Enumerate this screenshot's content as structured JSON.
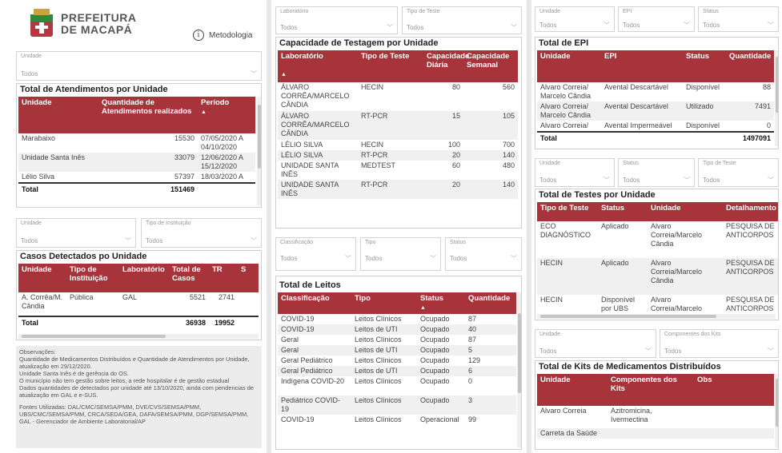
{
  "logo": {
    "line1": "PREFEITURA",
    "line2": "DE MACAPÁ",
    "metodologia": "Metodologia",
    "info_glyph": "i"
  },
  "col1": {
    "slicer_unidade": {
      "label": "Unidade",
      "value": "Todos"
    },
    "atend": {
      "title": "Total de Atendimentos por Unidade",
      "headers": [
        "Unidade",
        "Quantidade de Atendimentos realizados",
        "Período"
      ],
      "sort_glyph": "▲",
      "rows": [
        [
          "Marabaixo",
          "15530",
          "07/05/2020 A 04/10/2020"
        ],
        [
          "Unidade Santa Inês",
          "33079",
          "12/06/2020 A 15/12/2020"
        ],
        [
          "Lélio Silva",
          "57397",
          "18/03/2020 A"
        ]
      ],
      "total": [
        "Total",
        "151469",
        ""
      ]
    },
    "slicer_unidade2": {
      "label": "Unidade",
      "value": "Todos"
    },
    "slicer_tipo_inst": {
      "label": "Tipo de Instituição",
      "value": "Todos"
    },
    "casos": {
      "title": "Casos Detectados po Unidade",
      "headers": [
        "Unidade",
        "Tipo de Instituição",
        "Laboratório",
        "Total de Casos",
        "TR",
        "S"
      ],
      "rows": [
        [
          "A. Corrêa/M. Cândia",
          "Pública",
          "GAL",
          "5521",
          "2741",
          ""
        ]
      ],
      "total": [
        "Total",
        "",
        "",
        "36938",
        "19952",
        ""
      ]
    },
    "obs": [
      "Observações:",
      "Quantidade de Medicamentos Distribuídos e Quantidade de Atendimentos por Unidade, atualização em 29/12/2020.",
      "Unidade Santa Inês é de gerência do OS.",
      "O município não tem gestão sobre leitos, a rede hospitalar é de gestão estadual",
      "Dados quantidades de detectados por unidade até 13/10/2020, ainda com pendencias de atualização em GAL e e-SUS.",
      "",
      "Fontes Utilizadas: DAL/CMC/SEMSA/PMM, DVE/CVS/SEMSA/PMM, UBS/CMC/SEMSA/PMM, CRCA/SEDA/GEA, DAFA/SEMSA/PMM, DGP/SEMSA/PMM, GAL - Gerenciador de Ambiente Laboratorial/AP"
    ]
  },
  "col2": {
    "slicer_lab": {
      "label": "Laboratório",
      "value": "Todos"
    },
    "slicer_tipo_teste": {
      "label": "Tipo de Teste",
      "value": "Todos"
    },
    "cap": {
      "title": "Capacidade de Testagem por Unidade",
      "headers": [
        "Laboratório",
        "Tipo de Teste",
        "Capacidade Diária",
        "Capacidade Semanal"
      ],
      "sort_glyph": "▲",
      "rows": [
        [
          "ÁLVARO CORRÊA/MARCELO CÂNDIA",
          "HECIN",
          "80",
          "560"
        ],
        [
          "ÁLVARO CORRÊA/MARCELO CÂNDIA",
          "RT-PCR",
          "15",
          "105"
        ],
        [
          "LÉLIO SILVA",
          "HECIN",
          "100",
          "700"
        ],
        [
          "LÉLIO SILVA",
          "RT-PCR",
          "20",
          "140"
        ],
        [
          "UNIDADE SANTA INÊS",
          "MEDTEST",
          "60",
          "480"
        ],
        [
          "UNIDADE SANTA INÊS",
          "RT-PCR",
          "20",
          "140"
        ]
      ]
    },
    "slicer_class": {
      "label": "Classificação",
      "value": "Todos"
    },
    "slicer_tipo": {
      "label": "Tipo",
      "value": "Todos"
    },
    "slicer_status": {
      "label": "Status",
      "value": "Todos"
    },
    "leitos": {
      "title": "Total de Leitos",
      "headers": [
        "Classificação",
        "Tipo",
        "Status",
        "Quantidade"
      ],
      "sort_glyph": "▲",
      "rows": [
        [
          "COVID-19",
          "Leitos Clínicos",
          "Ocupado",
          "87"
        ],
        [
          "COVID-19",
          "Leitos de UTI",
          "Ocupado",
          "40"
        ],
        [
          "Geral",
          "Leitos Clínicos",
          "Ocupado",
          "87"
        ],
        [
          "Geral",
          "Leitos de UTI",
          "Ocupado",
          "5"
        ],
        [
          "Geral Pediátrico",
          "Leitos Clínicos",
          "Ocupado",
          "129"
        ],
        [
          "Geral Pediátrico",
          "Leitos de UTI",
          "Ocupado",
          "6"
        ],
        [
          "Indígena COVID-20",
          "Leitos Clínicos",
          "Ocupado",
          "0"
        ],
        [
          "Pediátrico COVID-19",
          "Leitos Clínicos",
          "Ocupado",
          "3"
        ],
        [
          "COVID-19",
          "Leitos Clínicos",
          "Operacional",
          "99"
        ]
      ]
    }
  },
  "col3": {
    "slicer_unidade": {
      "label": "Unidade",
      "value": "Todos"
    },
    "slicer_epi": {
      "label": "EPI",
      "value": "Todos"
    },
    "slicer_status": {
      "label": "Status",
      "value": "Todos"
    },
    "epi": {
      "title": "Total de EPI",
      "headers": [
        "Unidade",
        "EPI",
        "Status",
        "Quantidade"
      ],
      "rows": [
        [
          "Alvaro Correia/ Marcelo Cândia",
          "Avental Descartável",
          "Disponível",
          "88"
        ],
        [
          "Alvaro Correia/ Marcelo Cândia",
          "Avental Descartável",
          "Utilizado",
          "7491"
        ],
        [
          "Alvaro Correia/",
          "Avental Impermeável",
          "Disponível",
          "0"
        ]
      ],
      "total": [
        "Total",
        "",
        "",
        "1497091"
      ]
    },
    "slicer_unidade2": {
      "label": "Unidade",
      "value": "Todos"
    },
    "slicer_status2": {
      "label": "Status",
      "value": "Todos"
    },
    "slicer_tipo_teste": {
      "label": "Tipo de Teste",
      "value": "Todos"
    },
    "testes": {
      "title": "Total de Testes por Unidade",
      "headers": [
        "Tipo de Teste",
        "Status",
        "Unidade",
        "Detalhamento"
      ],
      "rows": [
        [
          "ECO DIAGNÓSTICO",
          "Aplicado",
          "Alvaro Correia/Marcelo Cândia",
          "PESQUISA DE ANTICORPOS"
        ],
        [
          "HECIN",
          "Aplicado",
          "Alvaro Correia/Marcelo Cândia",
          "PESQUISA DE ANTICORPOS"
        ],
        [
          "HECIN",
          "Disponível por UBS",
          "Alvaro Correia/Marcelo",
          "PESQUISA DE ANTICORPOS"
        ]
      ]
    },
    "slicer_unidade3": {
      "label": "Unidade",
      "value": "Todos"
    },
    "slicer_comp": {
      "label": "Componentes dos Kits",
      "value": "Todos"
    },
    "kits": {
      "title": "Total de Kits de Medicamentos Distribuídos",
      "headers": [
        "Unidade",
        "Componentes dos Kits",
        "Obs"
      ],
      "rows": [
        [
          "Alvaro Correia",
          "Azitromicina, Ivermectina",
          ""
        ],
        [
          "Carreta da Saúde",
          "",
          ""
        ]
      ]
    }
  },
  "colors": {
    "header_red": "#a8343b",
    "logo_red": "#b03a3f",
    "logo_green": "#2f8a3e"
  },
  "icons": {
    "chevron": "chevron-down-icon",
    "info": "info-circle-icon"
  }
}
